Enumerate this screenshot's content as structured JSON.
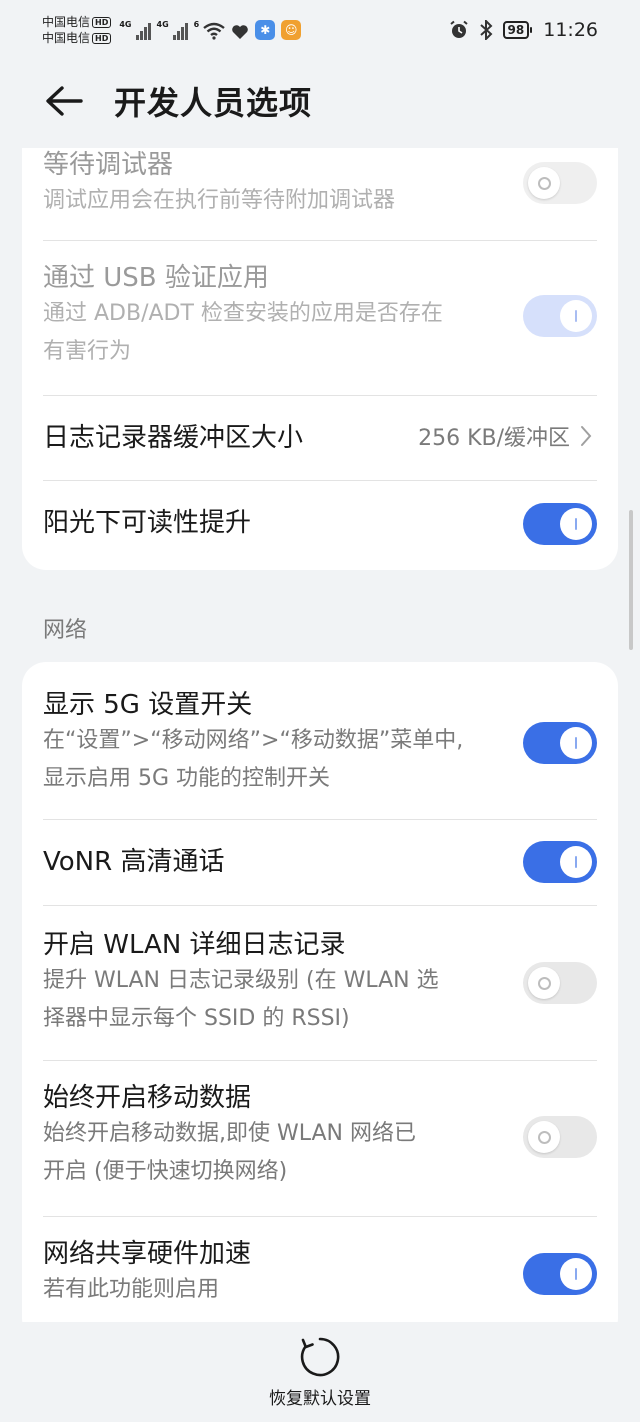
{
  "status_bar": {
    "carrier_1": "中国电信",
    "carrier_2": "中国电信",
    "hd_badge": "HD",
    "net_type_1": "4G",
    "net_type_2": "4G",
    "wifi_badge": "6",
    "battery": "98",
    "time": "11:26"
  },
  "header": {
    "title": "开发人员选项"
  },
  "card_debug": {
    "rows": [
      {
        "title": "等待调试器",
        "subtitle": "调试应用会在执行前等待附加调试器",
        "toggle": "off",
        "disabled": true
      },
      {
        "title": "通过 USB 验证应用",
        "subtitle_line1": "通过 ADB/ADT 检查安装的应用是否存在",
        "subtitle_line2": "有害行为",
        "toggle": "on",
        "disabled": true
      },
      {
        "title": "日志记录器缓冲区大小",
        "value": "256 KB/缓冲区"
      },
      {
        "title": "阳光下可读性提升",
        "toggle": "on"
      }
    ]
  },
  "section_network": {
    "label": "网络"
  },
  "card_network": {
    "rows": [
      {
        "title": "显示 5G 设置开关",
        "subtitle_line1": "在“设置”>“移动网络”>“移动数据”菜单中,",
        "subtitle_line2": "显示启用 5G 功能的控制开关",
        "toggle": "on"
      },
      {
        "title": "VoNR 高清通话",
        "toggle": "on"
      },
      {
        "title": "开启 WLAN 详细日志记录",
        "subtitle_line1": "提升 WLAN 日志记录级别 (在 WLAN 选",
        "subtitle_line2": "择器中显示每个 SSID 的 RSSI)",
        "toggle": "off"
      },
      {
        "title": "始终开启移动数据",
        "subtitle_line1": "始终开启移动数据,即使 WLAN 网络已",
        "subtitle_line2": "开启 (便于快速切换网络)",
        "toggle": "off"
      },
      {
        "title": "网络共享硬件加速",
        "subtitle": "若有此功能则启用",
        "toggle": "on"
      }
    ]
  },
  "bottom": {
    "reset_label": "恢复默认设置"
  },
  "colors": {
    "accent": "#3a6fe6",
    "background": "#f1f3f5",
    "card": "#ffffff"
  }
}
